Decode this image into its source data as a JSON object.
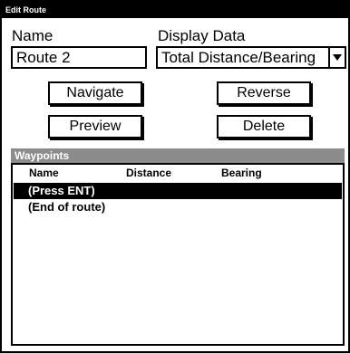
{
  "window": {
    "title": "Edit Route"
  },
  "name_field": {
    "label": "Name",
    "value": "Route 2"
  },
  "display_data": {
    "label": "Display Data",
    "selected": "Total Distance/Bearing"
  },
  "buttons": {
    "navigate": "Navigate",
    "reverse": "Reverse",
    "preview": "Preview",
    "delete": "Delete"
  },
  "waypoints": {
    "header": "Waypoints",
    "columns": [
      "Name",
      "Distance",
      "Bearing"
    ],
    "rows": [
      {
        "name": "(Press ENT)",
        "selected": true
      },
      {
        "name": "(End of route)",
        "selected": false
      }
    ]
  },
  "icons": {
    "dropdown": "chevron-down-icon"
  }
}
